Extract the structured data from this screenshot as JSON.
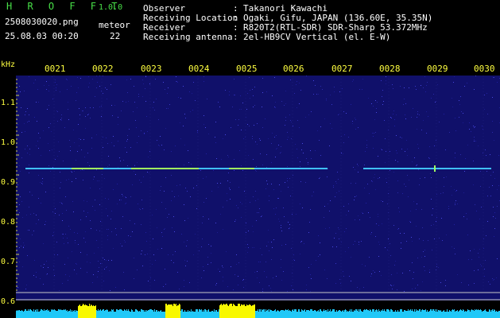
{
  "header": {
    "app_title": "H R O F F T",
    "app_version": "1.0.0",
    "file_name": "2508030020.png",
    "meteor_label": "meteor",
    "datetime": "25.08.03 00:20",
    "meteor_count": "22"
  },
  "metadata": [
    {
      "label": "Observer",
      "value": "Takanori Kawachi"
    },
    {
      "label": "Receiving Location",
      "value": "Ogaki, Gifu, JAPAN (136.60E, 35.35N)"
    },
    {
      "label": "Receiver",
      "value": "R820T2(RTL-SDR) SDR-Sharp 53.372MHz"
    },
    {
      "label": "Receiving antenna",
      "value": "2el-HB9CV Vertical (el. E-W)"
    }
  ],
  "spectrogram": {
    "y_unit": "kHz",
    "y_ticks": [
      "1.1",
      "1.0",
      "0.9",
      "0.8",
      "0.7",
      "0.6"
    ],
    "x_ticks": [
      "0021",
      "0022",
      "0023",
      "0024",
      "0025",
      "0026",
      "0027",
      "0028",
      "0029",
      "0030"
    ],
    "colors": {
      "background": "#000000",
      "plot_bg": "#10106a",
      "signal": "#40c0ff",
      "signal_hot": "#a0ff60",
      "label_green": "#48e048",
      "bottom_cyan": "#20c8f8",
      "bottom_yellow": "#f8f800"
    }
  }
}
